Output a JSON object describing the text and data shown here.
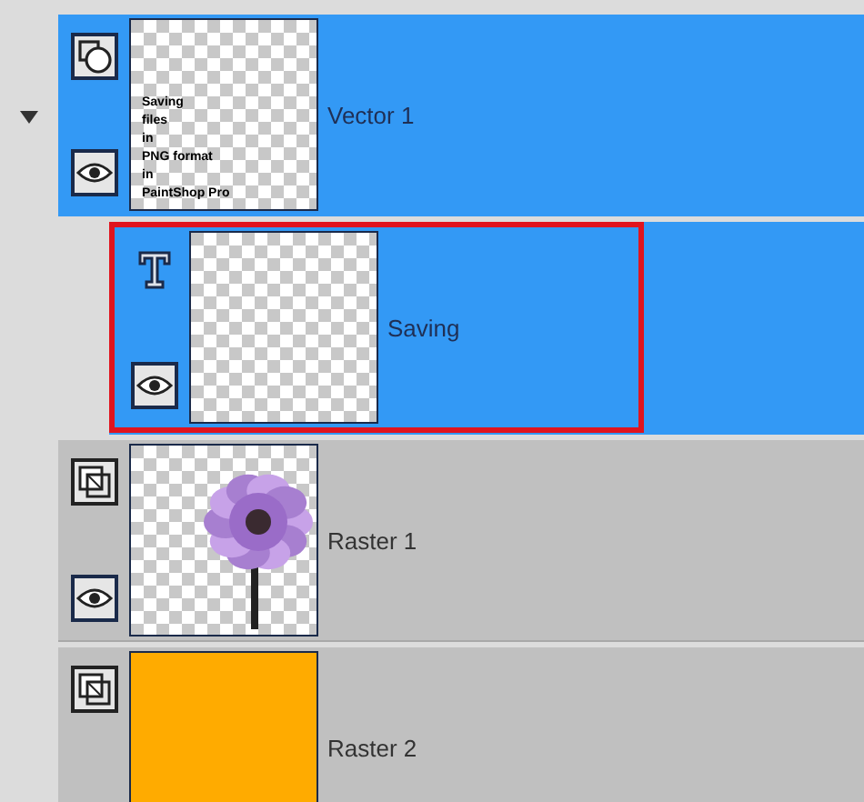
{
  "layers": [
    {
      "name": "Vector 1",
      "kind": "vector",
      "visible": true,
      "selected": true,
      "expanded": true,
      "highlighted": false,
      "thumbnail": {
        "kind": "text",
        "lines": [
          "Saving",
          "files",
          "in",
          "PNG format",
          "in",
          "PaintShop Pro"
        ]
      },
      "children": [
        {
          "name": "Saving",
          "kind": "text",
          "visible": true,
          "selected": true,
          "highlighted": true,
          "thumbnail": {
            "kind": "empty"
          }
        }
      ]
    },
    {
      "name": "Raster 1",
      "kind": "raster",
      "visible": true,
      "selected": false,
      "highlighted": false
    },
    {
      "name": "Raster 2",
      "kind": "raster",
      "selected": false,
      "highlighted": false,
      "thumbnail": {
        "kind": "fill",
        "color": "#ffab00"
      }
    }
  ]
}
